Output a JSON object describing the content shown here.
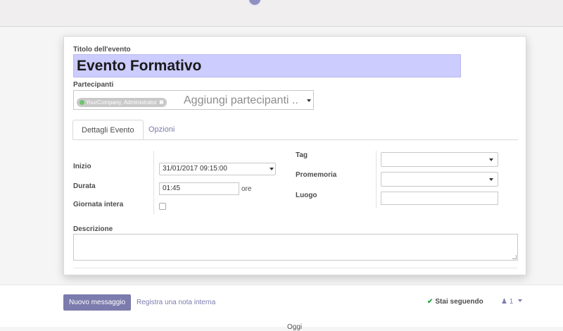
{
  "form": {
    "title_label": "Titolo dell'evento",
    "title_value": "Evento Formativo",
    "attendees_label": "Partecipanti",
    "attendee_chip": "YourCompany, Administrator",
    "attendees_placeholder": "Aggiungi partecipanti ..",
    "tabs": [
      {
        "label": "Dettagli Evento",
        "active": true
      },
      {
        "label": "Opzioni",
        "active": false
      }
    ],
    "start_label": "Inizio",
    "start_value": "31/01/2017 09:15:00",
    "duration_label": "Durata",
    "duration_value": "01:45",
    "duration_unit": "ore",
    "allday_label": "Giornata intera",
    "allday_checked": false,
    "tag_label": "Tag",
    "tag_value": "",
    "reminder_label": "Promemoria",
    "reminder_value": "",
    "location_label": "Luogo",
    "location_value": "",
    "description_label": "Descrizione",
    "description_value": ""
  },
  "chatter": {
    "new_message_button": "Nuovo messaggio",
    "log_note_link": "Registra una nota interna",
    "following_label": "Stai seguendo",
    "followers_count": "1",
    "date_separator": "Oggi"
  },
  "colors": {
    "accent": "#7c7bad",
    "title_highlight": "#ccccff",
    "following_check": "#28a745"
  },
  "icons": [
    "check-icon",
    "user-icon",
    "caret-down-icon",
    "close-icon"
  ]
}
